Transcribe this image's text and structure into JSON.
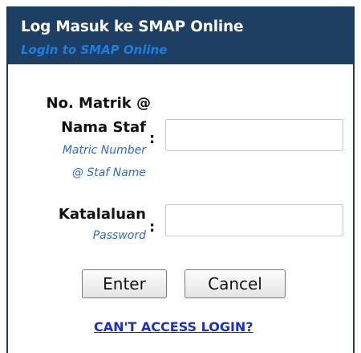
{
  "header": {
    "title": "Log Masuk ke SMAP Online",
    "subtitle": "Login to SMAP Online"
  },
  "form": {
    "username": {
      "label_line1": "No. Matrik @",
      "label_line2": "Nama Staf",
      "label_en_line1": "Matric Number",
      "label_en_line2": "@ Staf Name",
      "separator": ":",
      "value": ""
    },
    "password": {
      "label": "Katalaluan",
      "label_en": "Password",
      "separator": ":",
      "value": ""
    }
  },
  "buttons": {
    "enter_label": "Enter",
    "cancel_label": "Cancel"
  },
  "links": {
    "cant_access": "CAN'T ACCESS LOGIN?"
  },
  "colors": {
    "header_bg": "#1d3f63",
    "header_title": "#ffffff",
    "header_subtitle": "#1e7fe0",
    "label_en": "#2d6ad1",
    "link": "#1a2fcf"
  }
}
